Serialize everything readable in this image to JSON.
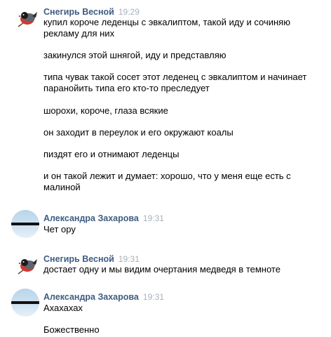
{
  "messages": [
    {
      "author": "Снегирь Весной",
      "time": "19:29",
      "lines": [
        "купил короче леденцы с эвкалиптом, такой иду и сочиняю рекламу для них",
        "закинулся этой шнягой, иду и представляю",
        "типа чувак такой сосет этот леденец с эвкалиптом и начинает паранойить типа его кто-то преследует",
        "шорохи, короче, глаза всякие",
        "он заходит в переулок и его окружают коалы",
        "пиздят его и отнимают леденцы",
        "и он такой лежит и думает: хорошо, что у меня еще есть с малиной"
      ]
    },
    {
      "author": "Александра Захарова",
      "time": "19:31",
      "lines": [
        "Чет ору"
      ]
    },
    {
      "author": "Снегирь Весной",
      "time": "19:31",
      "lines": [
        "достает одну и мы видим очертания медведя в темноте"
      ]
    },
    {
      "author": "Александра Захарова",
      "time": "19:31",
      "lines": [
        "Ахахахах",
        "Божественно"
      ]
    }
  ]
}
